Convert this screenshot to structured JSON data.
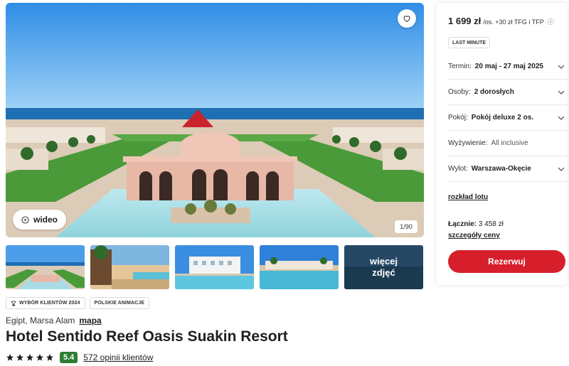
{
  "gallery": {
    "video_label": "wideo",
    "counter": "1/90",
    "more_photos_label": "więcej zdjęć",
    "thumbnails": [
      "resort-aerial",
      "pool-terrace",
      "hotel-building",
      "beach-resort",
      "more-photos"
    ]
  },
  "badges": [
    "WYBÓR KLIENTÓW 2024",
    "POLSKIE ANIMACJE"
  ],
  "location": {
    "text": "Egipt, Marsa Alam",
    "map_link": "mapa"
  },
  "hotel": {
    "name": "Hotel Sentido Reef Oasis Suakin Resort",
    "stars": 5,
    "score": "5.4",
    "reviews_link": "572 opinii klientów"
  },
  "booking": {
    "price": "1 699 zł",
    "price_suffix": "/os. +30 zł TFG i TFP",
    "info_icon": "ⓘ",
    "badge": "LAST MINUTE",
    "options": {
      "term": {
        "label": "Termin:",
        "value": "20 maj - 27 maj 2025"
      },
      "people": {
        "label": "Osoby:",
        "value": "2 dorosłych"
      },
      "room": {
        "label": "Pokój:",
        "value": "Pokój deluxe 2 os."
      },
      "board": {
        "label": "Wyżywienie:",
        "value": "All inclusive"
      },
      "departure": {
        "label": "Wylot:",
        "value": "Warszawa-Okęcie"
      }
    },
    "flight_schedule_link": "rozkład lotu",
    "total_label": "Łącznie:",
    "total_value": "3 458 zł",
    "price_details_link": "szczegóły ceny",
    "reserve_label": "Rezerwuj"
  },
  "colors": {
    "accent_red": "#d71f2b",
    "score_green": "#2e7d32"
  }
}
